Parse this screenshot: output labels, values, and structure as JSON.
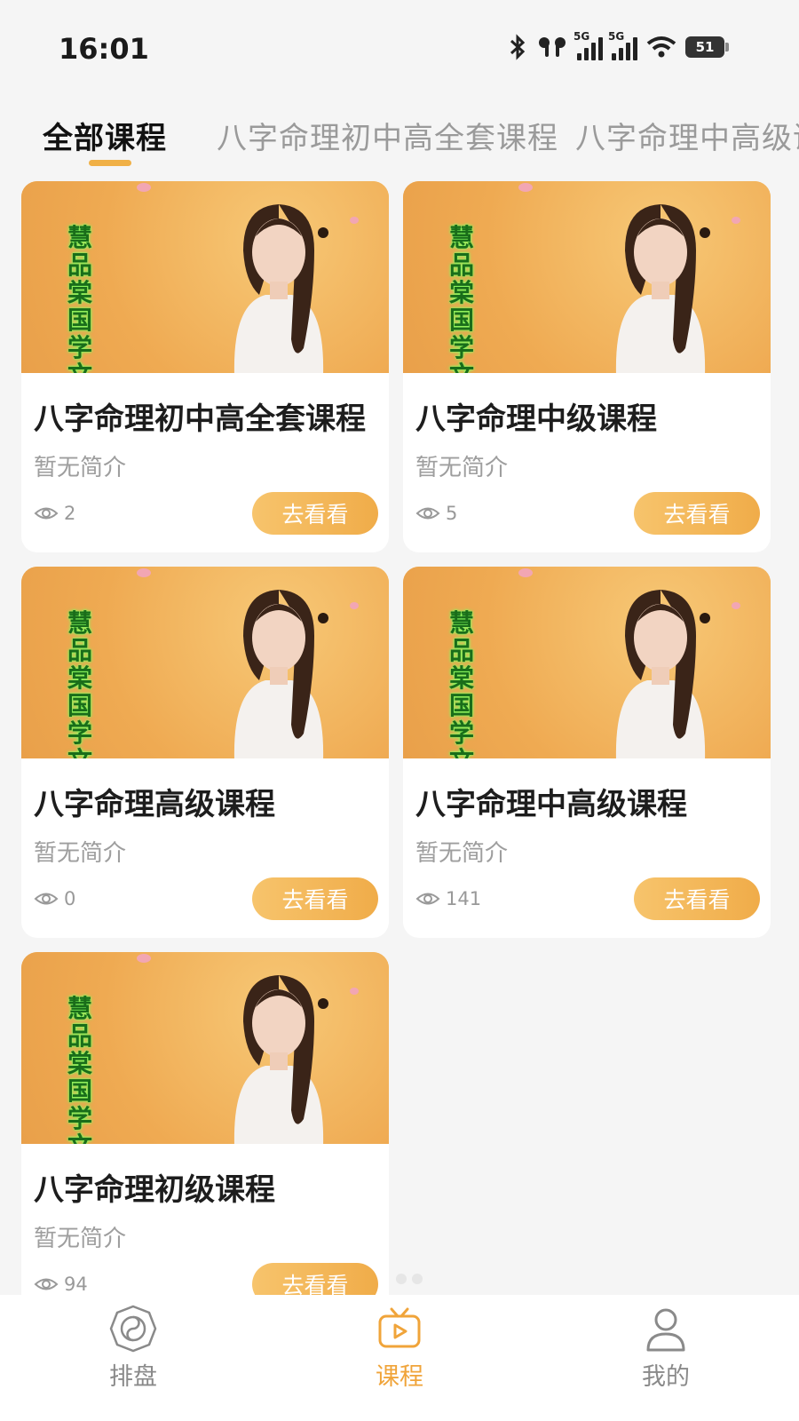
{
  "status_bar": {
    "time": "16:01",
    "signal_label_1": "5G",
    "signal_label_2": "5G",
    "battery": "51"
  },
  "tabs": [
    {
      "label": "全部课程",
      "active": true
    },
    {
      "label": "八字命理初中高全套课程",
      "active": false
    },
    {
      "label": "八字命理中高级课程",
      "active": false
    }
  ],
  "thumbnail_text": "慧品棠国学文化",
  "courses": [
    {
      "title": "八字命理初中高全套课程",
      "description": "暂无简介",
      "views": "2",
      "button": "去看看"
    },
    {
      "title": "八字命理中级课程",
      "description": "暂无简介",
      "views": "5",
      "button": "去看看"
    },
    {
      "title": "八字命理高级课程",
      "description": "暂无简介",
      "views": "0",
      "button": "去看看"
    },
    {
      "title": "八字命理中高级课程",
      "description": "暂无简介",
      "views": "141",
      "button": "去看看"
    },
    {
      "title": "八字命理初级课程",
      "description": "暂无简介",
      "views": "94",
      "button": "去看看"
    }
  ],
  "bottom_nav": [
    {
      "label": "排盘",
      "icon": "bagua-icon",
      "active": false
    },
    {
      "label": "课程",
      "icon": "tv-play-icon",
      "active": true
    },
    {
      "label": "我的",
      "icon": "user-icon",
      "active": false
    }
  ],
  "colors": {
    "accent": "#f0ac49",
    "thumbnail_bg": "#f0b15a",
    "calligraphy": "#1a6d1a"
  }
}
